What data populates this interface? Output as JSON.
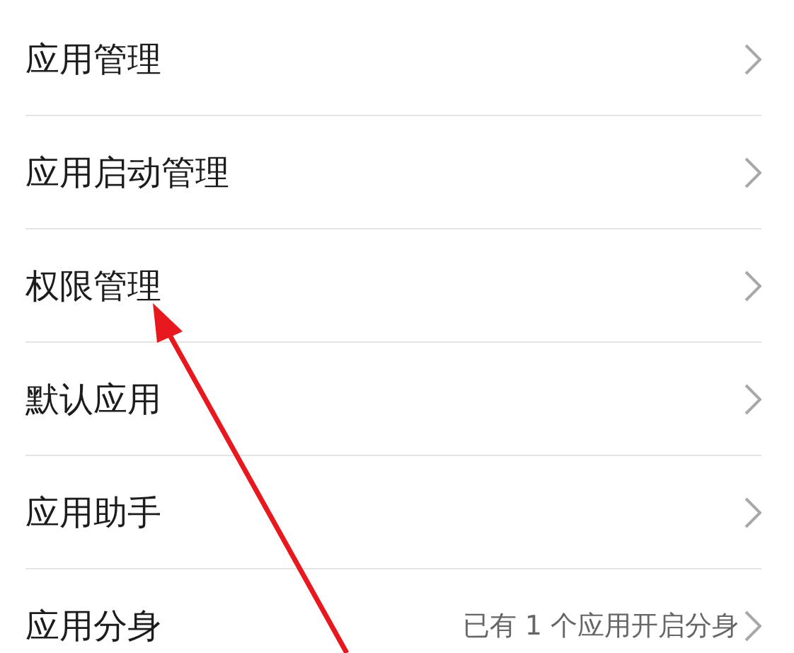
{
  "items": [
    {
      "label": "应用管理"
    },
    {
      "label": "应用启动管理"
    },
    {
      "label": "权限管理"
    },
    {
      "label": "默认应用"
    },
    {
      "label": "应用助手"
    },
    {
      "label": "应用分身",
      "detail": "已有 1 个应用开启分身"
    }
  ]
}
